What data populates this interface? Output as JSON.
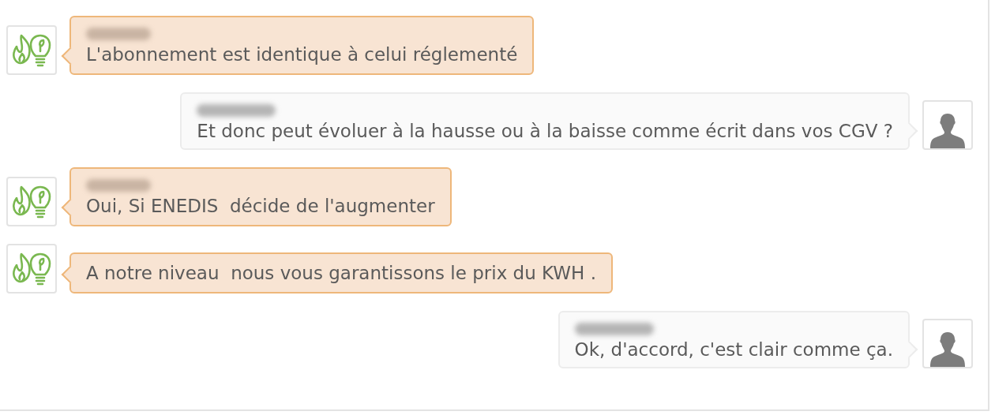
{
  "messages": [
    {
      "kind": "agent",
      "name_shown": true,
      "text": "L'abonnement est identique à celui réglementé"
    },
    {
      "kind": "customer",
      "name_shown": true,
      "text": "Et donc peut évoluer à la hausse ou à la baisse comme écrit dans vos CGV ?"
    },
    {
      "kind": "agent",
      "name_shown": true,
      "text": "Oui, Si ENEDIS  décide de l'augmenter"
    },
    {
      "kind": "agent",
      "name_shown": false,
      "text": "A notre niveau  nous vous garantissons le prix du KWH ."
    },
    {
      "kind": "customer",
      "name_shown": true,
      "text": "Ok, d'accord, c'est clair comme ça."
    }
  ]
}
